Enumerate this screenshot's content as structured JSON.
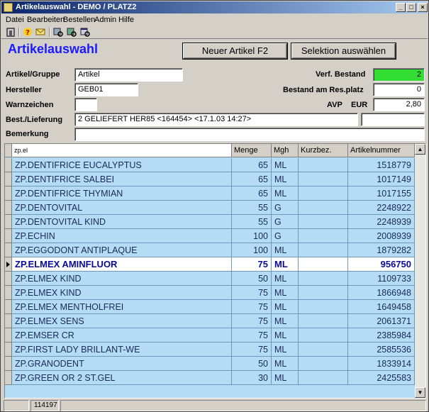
{
  "window": {
    "title": "Artikelauswahl - DEMO / PLATZ2",
    "controls": {
      "minimize": "_",
      "maximize": "□",
      "close": "×"
    }
  },
  "menu": [
    "Datei",
    "Bearbeiten",
    "Bestellen",
    "Admin",
    "Hilfe"
  ],
  "toolbar_icons": [
    "exit-icon",
    "help-icon",
    "mail-icon",
    "search-user-icon",
    "search-article-icon",
    "search-window-icon"
  ],
  "heading": "Artikelauswahl",
  "buttons": {
    "new_article": "Neuer Artikel F2",
    "select_selection": "Selektion auswählen"
  },
  "form": {
    "artikel_gruppe_label": "Artikel/Gruppe",
    "artikel_gruppe_value": "Artikel",
    "hersteller_label": "Hersteller",
    "hersteller_value": "GEB01",
    "warnzeichen_label": "Warnzeichen",
    "warnzeichen_value": "",
    "best_lieferung_label": "Best./Lieferung",
    "best_lieferung_value": "2 GELIEFERT HER85 <164454> <17.1.03 14:27>",
    "best_lieferung_extra": "",
    "bemerkung_label": "Bemerkung",
    "bemerkung_value": "",
    "verf_bestand_label": "Verf. Bestand",
    "verf_bestand_value": "2",
    "bestand_res_label": "Bestand am Res.platz",
    "bestand_res_value": "0",
    "avp_label": "AVP",
    "eur_label": "EUR",
    "avp_value": "2,80",
    "colors": {
      "verf_bestand_bg": "#33dd33",
      "heading": "#1a1aff",
      "grid_bg": "#b5dcf5"
    }
  },
  "grid": {
    "search_value": "zp.el",
    "columns": [
      "Menge",
      "Mgh",
      "Kurzbez.",
      "Artikelnummer"
    ],
    "rows": [
      {
        "name": "ZP.DENTIFRICE EUCALYPTUS",
        "menge": "65",
        "mgh": "ML",
        "kurz": "",
        "nr": "1518779"
      },
      {
        "name": "ZP.DENTIFRICE SALBEI",
        "menge": "65",
        "mgh": "ML",
        "kurz": "",
        "nr": "1017149"
      },
      {
        "name": "ZP.DENTIFRICE THYMIAN",
        "menge": "65",
        "mgh": "ML",
        "kurz": "",
        "nr": "1017155"
      },
      {
        "name": "ZP.DENTOVITAL",
        "menge": "55",
        "mgh": "G",
        "kurz": "",
        "nr": "2248922"
      },
      {
        "name": "ZP.DENTOVITAL KIND",
        "menge": "55",
        "mgh": "G",
        "kurz": "",
        "nr": "2248939"
      },
      {
        "name": "ZP.ECHIN",
        "menge": "100",
        "mgh": "G",
        "kurz": "",
        "nr": "2008939"
      },
      {
        "name": "ZP.EGGODONT ANTIPLAQUE",
        "menge": "100",
        "mgh": "ML",
        "kurz": "",
        "nr": "1879282"
      },
      {
        "name": "ZP.ELMEX AMINFLUOR",
        "menge": "75",
        "mgh": "ML",
        "kurz": "",
        "nr": "956750",
        "selected": true
      },
      {
        "name": "ZP.ELMEX KIND",
        "menge": "50",
        "mgh": "ML",
        "kurz": "",
        "nr": "1109733"
      },
      {
        "name": "ZP.ELMEX KIND",
        "menge": "75",
        "mgh": "ML",
        "kurz": "",
        "nr": "1866948"
      },
      {
        "name": "ZP.ELMEX MENTHOLFREI",
        "menge": "75",
        "mgh": "ML",
        "kurz": "",
        "nr": "1649458"
      },
      {
        "name": "ZP.ELMEX SENS",
        "menge": "75",
        "mgh": "ML",
        "kurz": "",
        "nr": "2061371"
      },
      {
        "name": "ZP.EMSER CR",
        "menge": "75",
        "mgh": "ML",
        "kurz": "",
        "nr": "2385984"
      },
      {
        "name": "ZP.FIRST LADY BRILLANT-WE",
        "menge": "75",
        "mgh": "ML",
        "kurz": "",
        "nr": "2585536"
      },
      {
        "name": "ZP.GRANODENT",
        "menge": "50",
        "mgh": "ML",
        "kurz": "",
        "nr": "1833914"
      },
      {
        "name": "ZP.GREEN OR 2 ST.GEL",
        "menge": "30",
        "mgh": "ML",
        "kurz": "",
        "nr": "2425583"
      }
    ]
  },
  "status": {
    "value": "114197"
  }
}
